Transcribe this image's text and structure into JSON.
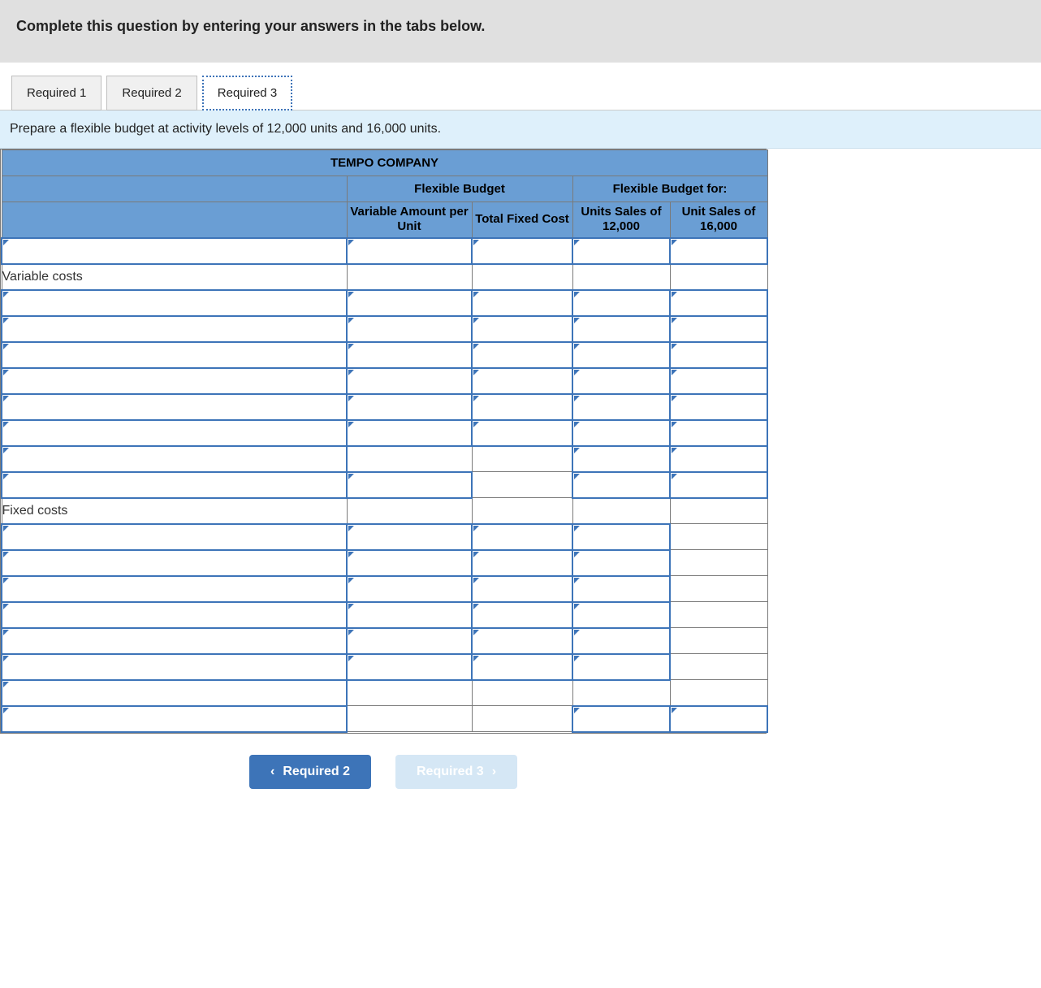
{
  "instruction": "Complete this question by entering your answers in the tabs below.",
  "tabs": [
    {
      "label": "Required 1",
      "selected": false
    },
    {
      "label": "Required 2",
      "selected": false
    },
    {
      "label": "Required 3",
      "selected": true
    }
  ],
  "prompt": "Prepare a flexible budget at activity levels of 12,000 units and 16,000 units.",
  "sheet": {
    "company": "TEMPO COMPANY",
    "group1": "Flexible Budget",
    "group2": "Flexible Budget for:",
    "col_var_amount": "Variable Amount per Unit",
    "col_fixed": "Total Fixed Cost",
    "col_u12": "Units Sales of 12,000",
    "col_u16": "Unit Sales of 16,000",
    "section_variable": "Variable costs",
    "section_fixed": "Fixed costs"
  },
  "nav": {
    "prev": "Required 2",
    "next": "Required 3"
  }
}
